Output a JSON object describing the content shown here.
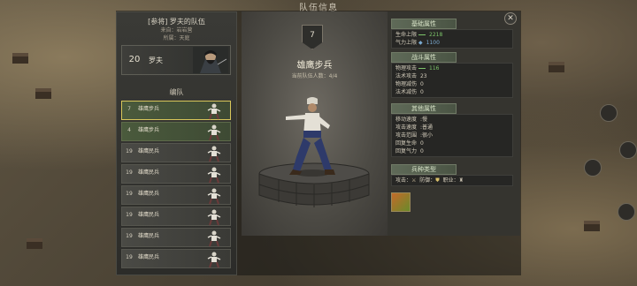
{
  "window": {
    "title": "队伍信息",
    "close_icon": "close-icon"
  },
  "left": {
    "team_title": "[参将] 罗夫的队伍",
    "source": "来自：岩岩营",
    "affiliation": "所属：天庭",
    "leader": {
      "level": "20",
      "name": "罗夫"
    },
    "section_label": "编队",
    "units": [
      {
        "level": "7",
        "name": "雄鹰步兵",
        "style": "green",
        "selected": true
      },
      {
        "level": "4",
        "name": "雄鹰步兵",
        "style": "green",
        "selected": false
      },
      {
        "level": "19",
        "name": "雄鹰民兵",
        "style": "gray",
        "selected": false
      },
      {
        "level": "19",
        "name": "雄鹰民兵",
        "style": "gray",
        "selected": false
      },
      {
        "level": "19",
        "name": "雄鹰民兵",
        "style": "gray",
        "selected": false
      },
      {
        "level": "19",
        "name": "雄鹰民兵",
        "style": "gray",
        "selected": false
      },
      {
        "level": "19",
        "name": "雄鹰民兵",
        "style": "gray",
        "selected": false
      },
      {
        "level": "19",
        "name": "雄鹰民兵",
        "style": "gray",
        "selected": false
      }
    ]
  },
  "center": {
    "level": "7",
    "unit_name": "雄鹰步兵",
    "troop_count": "当前队伍人数：4/4"
  },
  "right": {
    "basic": {
      "title": "基础属性",
      "rows": [
        {
          "label": "生命上限",
          "value": "2218"
        },
        {
          "label": "气力上限",
          "value": "1100"
        }
      ]
    },
    "combat": {
      "title": "战斗属性",
      "rows": [
        {
          "label": "物理攻击",
          "value": "116"
        },
        {
          "label": "法术攻击",
          "value": "23"
        },
        {
          "label": "物理减伤",
          "value": "0"
        },
        {
          "label": "法术减伤",
          "value": "0"
        }
      ]
    },
    "other": {
      "title": "其他属性",
      "rows": [
        {
          "label": "移动速度",
          "value": ":慢"
        },
        {
          "label": "攻击速度",
          "value": ":普通"
        },
        {
          "label": "攻击范围",
          "value": ":很小"
        },
        {
          "label": "回复生命",
          "value": "0"
        },
        {
          "label": "回复气力",
          "value": "0"
        }
      ]
    },
    "type": {
      "title": "兵种类型",
      "attack_label": "攻击：",
      "defense_label": "防御：",
      "job_label": "职业："
    }
  },
  "colors": {
    "accent_green": "#7cc46a",
    "selected_border": "#d8c65a"
  }
}
